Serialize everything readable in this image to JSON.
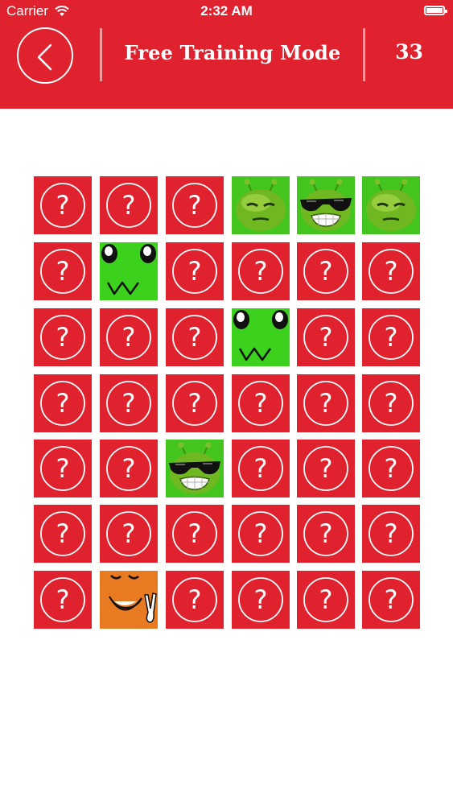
{
  "status_bar": {
    "carrier": "Carrier",
    "time": "2:32 AM",
    "wifi_icon": "wifi-icon",
    "battery_icon": "battery-icon"
  },
  "header": {
    "back_icon": "chevron-left-icon",
    "title": "Free Training Mode",
    "score": "33"
  },
  "colors": {
    "accent": "#e0212e",
    "tile_green": "#3bd11d",
    "tile_orange": "#e87a22"
  },
  "board": {
    "rows": 7,
    "cols": 6,
    "hidden_icon": "question-mark-icon",
    "revealed": [
      {
        "row": 0,
        "col": 3,
        "face": "alien-sleepy-icon"
      },
      {
        "row": 0,
        "col": 4,
        "face": "alien-sunglasses-icon"
      },
      {
        "row": 0,
        "col": 5,
        "face": "alien-sleepy-icon"
      },
      {
        "row": 1,
        "col": 1,
        "face": "green-cute-face-icon"
      },
      {
        "row": 2,
        "col": 3,
        "face": "green-cute-face-icon"
      },
      {
        "row": 4,
        "col": 2,
        "face": "alien-sunglasses-icon"
      },
      {
        "row": 6,
        "col": 1,
        "face": "orange-peace-face-icon"
      }
    ]
  }
}
